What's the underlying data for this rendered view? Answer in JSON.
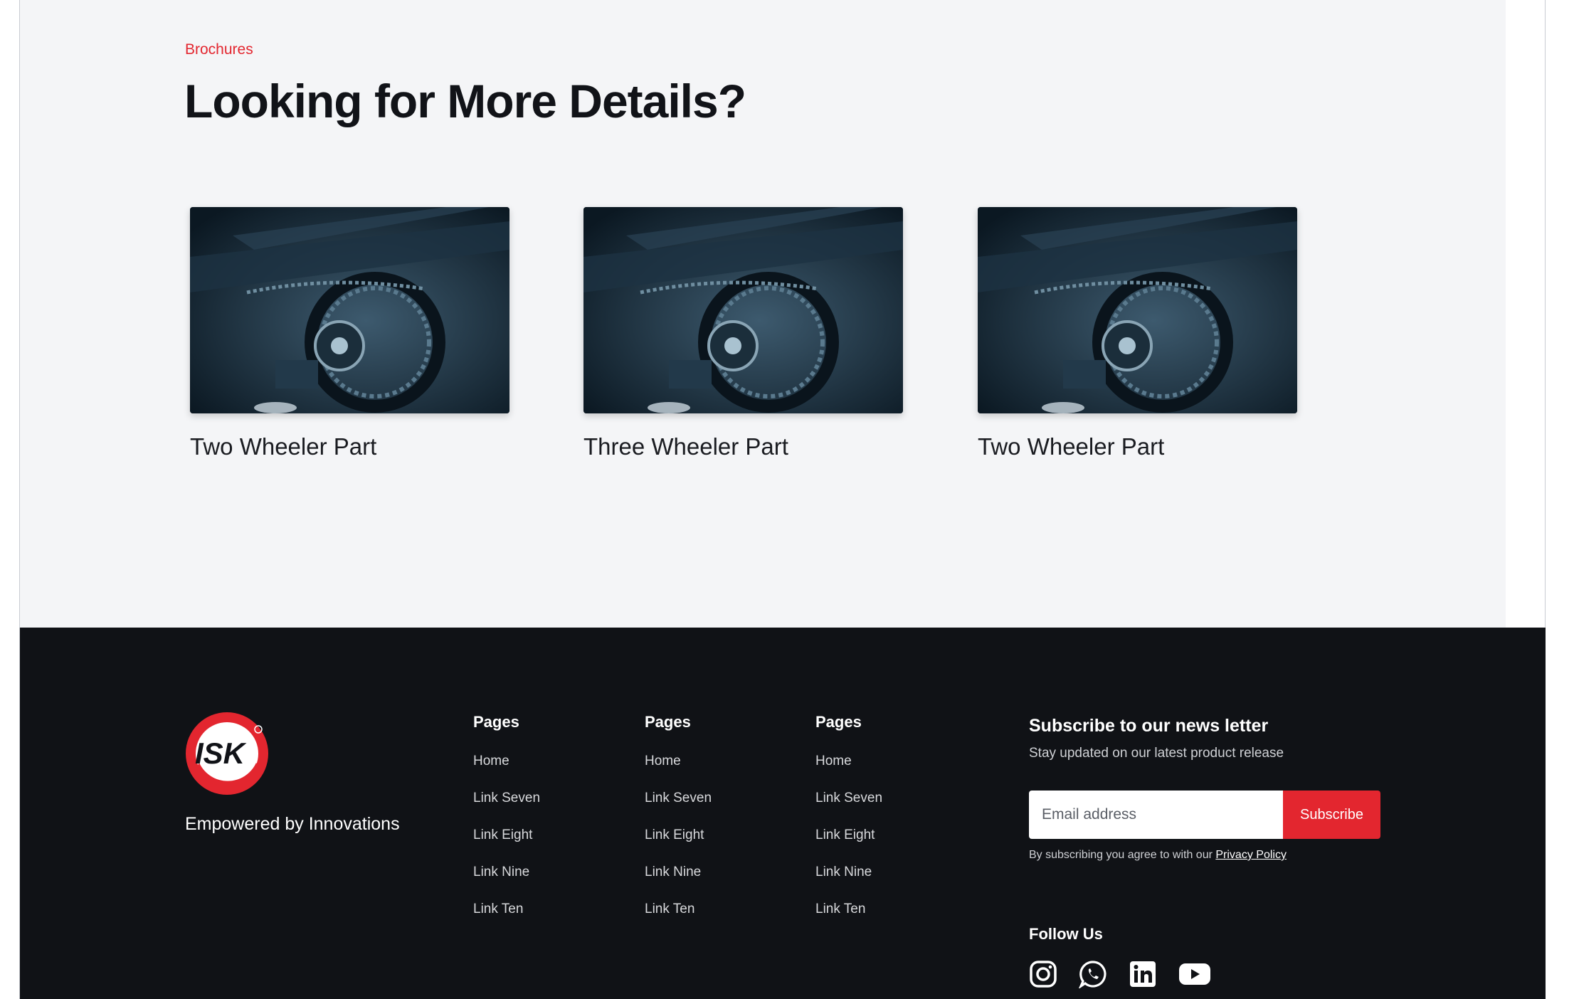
{
  "brochures": {
    "eyebrow": "Brochures",
    "title": "Looking for More Details?",
    "cards": [
      {
        "label": "Two Wheeler Part",
        "image": "motorcycle-chain-sprocket-photo"
      },
      {
        "label": "Three Wheeler Part",
        "image": "motorcycle-chain-sprocket-photo"
      },
      {
        "label": "Two Wheeler Part",
        "image": "motorcycle-chain-sprocket-photo"
      }
    ]
  },
  "footer": {
    "logo_text": "ISK",
    "tagline": "Empowered by Innovations",
    "columns": [
      {
        "title": "Pages",
        "links": [
          "Home",
          "Link Seven",
          "Link Eight",
          "Link Nine",
          "Link Ten"
        ]
      },
      {
        "title": "Pages",
        "links": [
          "Home",
          "Link Seven",
          "Link Eight",
          "Link Nine",
          "Link Ten"
        ]
      },
      {
        "title": "Pages",
        "links": [
          "Home",
          "Link Seven",
          "Link Eight",
          "Link Nine",
          "Link Ten"
        ]
      }
    ],
    "newsletter": {
      "title": "Subscribe to our news letter",
      "subtitle": "Stay updated on our latest product release",
      "email_placeholder": "Email address",
      "button_label": "Subscribe",
      "consent_text": "By subscribing you agree to with our",
      "privacy_link": "Privacy Policy"
    },
    "follow": {
      "title": "Follow Us",
      "icons": [
        "instagram-icon",
        "whatsapp-icon",
        "linkedin-icon",
        "youtube-icon"
      ]
    }
  },
  "colors": {
    "accent": "#e3262f",
    "footer_bg": "#101216",
    "section_bg": "#f4f5f7"
  }
}
